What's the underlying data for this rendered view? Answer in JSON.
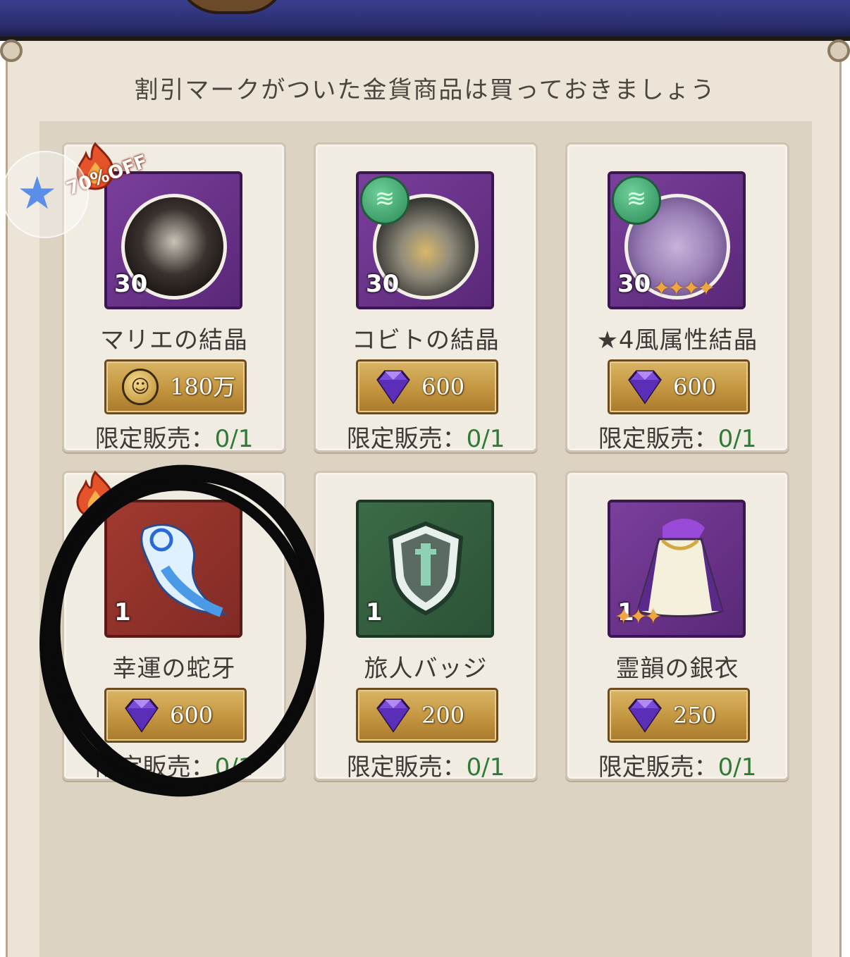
{
  "hint": "割引マークがついた金貨商品は買っておきましょう",
  "sale_badge": "70%OFF",
  "limit_label": "限定販売：",
  "items": [
    {
      "name": "マリエの結晶",
      "price": "180万",
      "currency": "gold-coin",
      "limit": "0/1",
      "count": "30",
      "stars": "",
      "thumb": "purple"
    },
    {
      "name": "コビトの結晶",
      "price": "600",
      "currency": "diamond",
      "limit": "0/1",
      "count": "30",
      "stars": "",
      "thumb": "purple"
    },
    {
      "name": "★4風属性結晶",
      "price": "600",
      "currency": "diamond",
      "limit": "0/1",
      "count": "30",
      "stars": "✦✦✦✦",
      "thumb": "purple"
    },
    {
      "name": "幸運の蛇牙",
      "price": "600",
      "currency": "diamond",
      "limit": "0/1",
      "count": "1",
      "stars": "",
      "thumb": "red"
    },
    {
      "name": "旅人バッジ",
      "price": "200",
      "currency": "diamond",
      "limit": "0/1",
      "count": "1",
      "stars": "",
      "thumb": "green"
    },
    {
      "name": "霊韻の銀衣",
      "price": "250",
      "currency": "diamond",
      "limit": "0/1",
      "count": "1",
      "stars": "✦✦✦",
      "thumb": "purple"
    }
  ],
  "colors": {
    "panel": "#ece4d6",
    "limit_value": "#2f7a36",
    "price_gold": "#c4953f"
  }
}
